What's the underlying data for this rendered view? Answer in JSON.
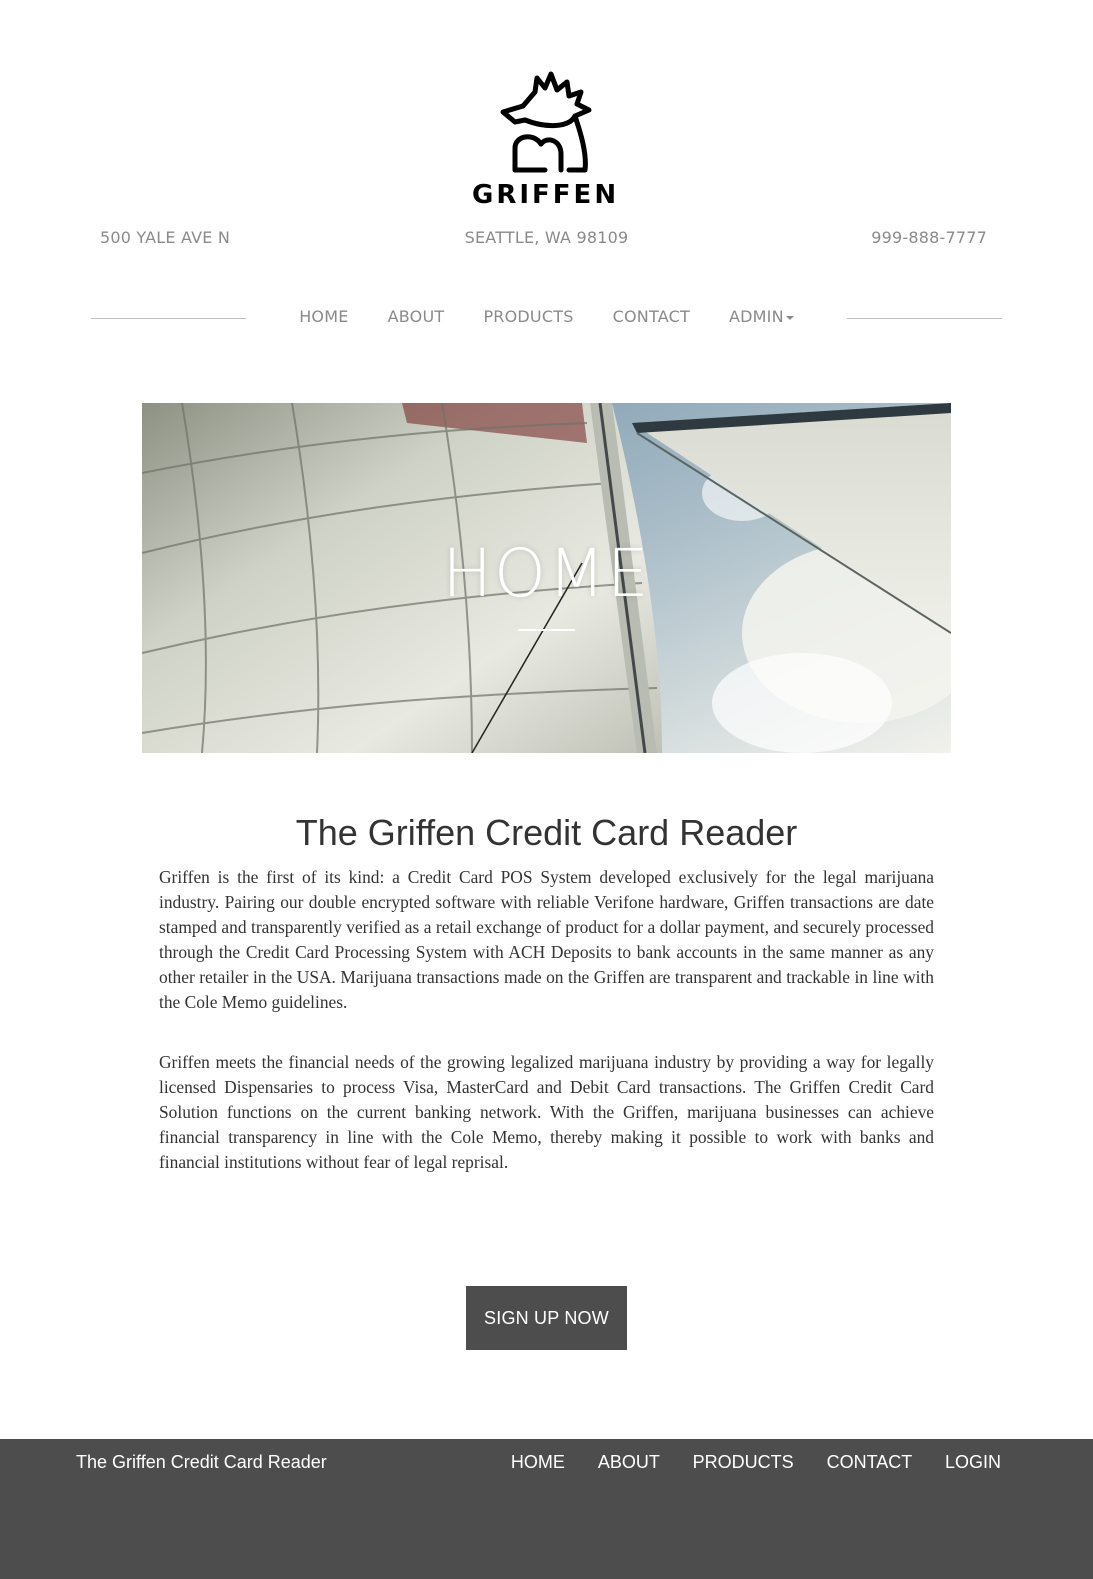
{
  "brand": {
    "name": "GRIFFEN"
  },
  "contact": {
    "street": "500 YALE AVE N",
    "city": "SEATTLE, WA 98109",
    "phone": "999-888-7777"
  },
  "topnav": {
    "items": [
      {
        "label": "HOME"
      },
      {
        "label": "ABOUT"
      },
      {
        "label": "PRODUCTS"
      },
      {
        "label": "CONTACT"
      },
      {
        "label": "ADMIN"
      }
    ]
  },
  "hero": {
    "title": "HOME"
  },
  "main": {
    "heading": "The Griffen Credit Card Reader",
    "paragraphs": [
      "Griffen is the first of its kind: a Credit Card POS System developed exclusively for the legal marijuana industry. Pairing our double encrypted software with reliable Verifone hardware, Griffen transactions are date stamped and transparently verified as a retail exchange of product for a dollar payment, and securely processed through the Credit Card Processing System with ACH Deposits to bank accounts in the same manner as any other retailer in the USA. Marijuana transactions made on the Griffen are transparent and trackable in line with the Cole Memo guidelines.",
      "Griffen meets the financial needs of the growing legalized marijuana industry by providing a way for legally licensed Dispensaries to process Visa, MasterCard and Debit Card transactions. The Griffen Credit Card Solution functions on the current banking network. With the Griffen, marijuana businesses can achieve financial transparency in line with the Cole Memo, thereby making it possible to work with banks and financial institutions without fear of legal reprisal."
    ],
    "cta_label": "SIGN UP NOW"
  },
  "footer": {
    "title": "The Griffen Credit Card Reader",
    "nav": [
      {
        "label": "HOME"
      },
      {
        "label": "ABOUT"
      },
      {
        "label": "PRODUCTS"
      },
      {
        "label": "CONTACT"
      },
      {
        "label": "LOGIN"
      }
    ]
  },
  "colors": {
    "footer_bg": "#4d4d4d",
    "nav_text": "#8a8a8a",
    "body_text": "#333333",
    "cta_bg": "#4d4d4d"
  }
}
